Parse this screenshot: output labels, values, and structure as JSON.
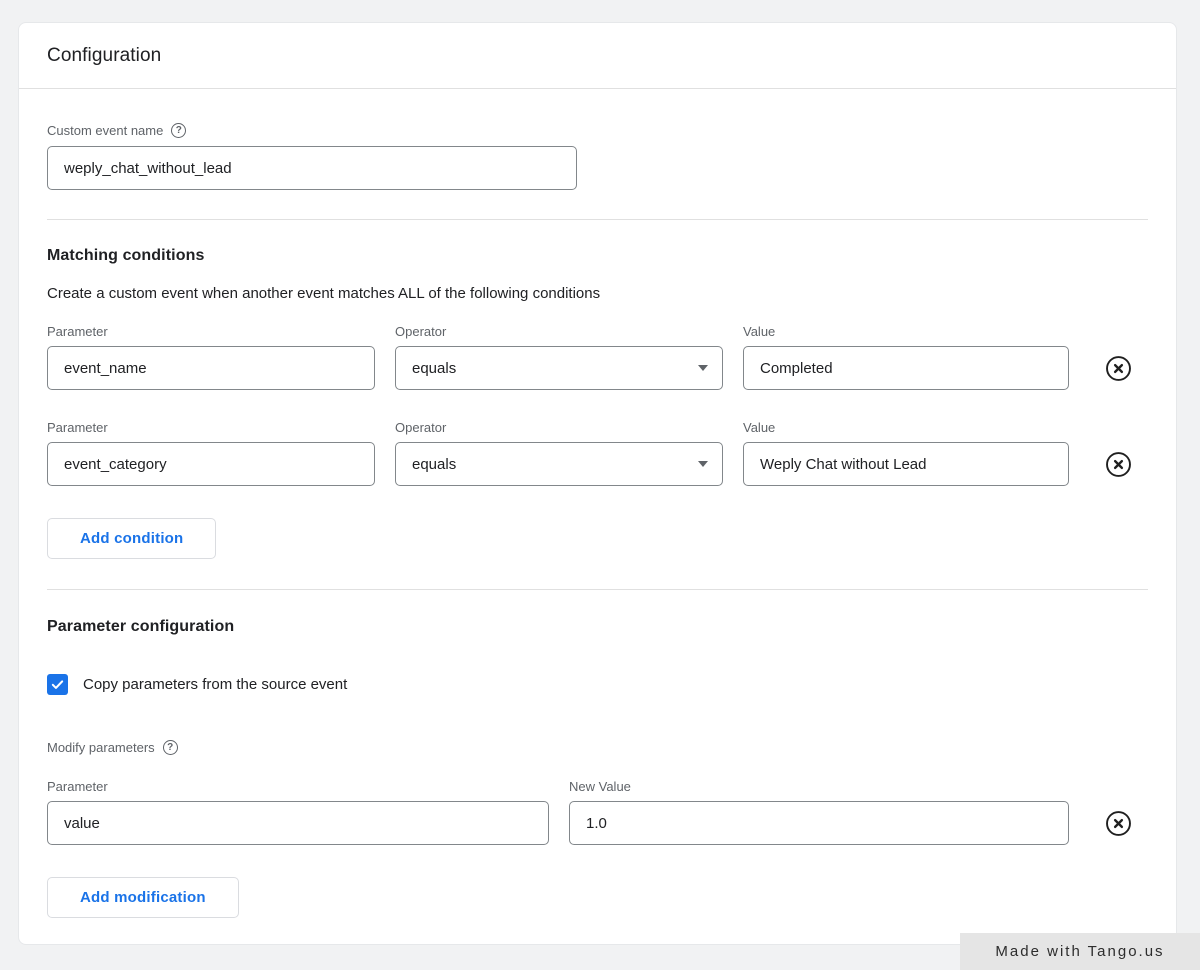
{
  "badge": {
    "label": "Made with Tango.us"
  },
  "configuration": {
    "title": "Configuration",
    "custom_event_name": {
      "label": "Custom event name",
      "value": "weply_chat_without_lead"
    },
    "matching_conditions": {
      "heading": "Matching conditions",
      "description": "Create a custom event when another event matches ALL of the following conditions",
      "labels": {
        "parameter": "Parameter",
        "operator": "Operator",
        "value": "Value"
      },
      "conditions": [
        {
          "parameter": "event_name",
          "operator": "equals",
          "value": "Completed"
        },
        {
          "parameter": "event_category",
          "operator": "equals",
          "value": "Weply Chat without Lead"
        }
      ],
      "add_condition_label": "Add condition"
    },
    "parameter_configuration": {
      "heading": "Parameter configuration",
      "copy_parameters_label": "Copy parameters from the source event",
      "copy_parameters_checked": true,
      "modify_parameters_label": "Modify parameters",
      "labels": {
        "parameter": "Parameter",
        "new_value": "New Value"
      },
      "modifications": [
        {
          "parameter": "value",
          "new_value": "1.0"
        }
      ],
      "add_modification_label": "Add modification"
    }
  },
  "icons": {
    "help_glyph": "?"
  },
  "colors": {
    "accent_blue": "#1a73e8",
    "text_primary": "#202124",
    "text_secondary": "#5f6368",
    "input_border": "#82878b",
    "button_border": "#dadce0",
    "divider": "#e0e0e0",
    "page_background": "#f1f2f3",
    "card_background": "#ffffff",
    "badge_background": "#e5e5e5",
    "badge_text": "#2d2d2d"
  }
}
